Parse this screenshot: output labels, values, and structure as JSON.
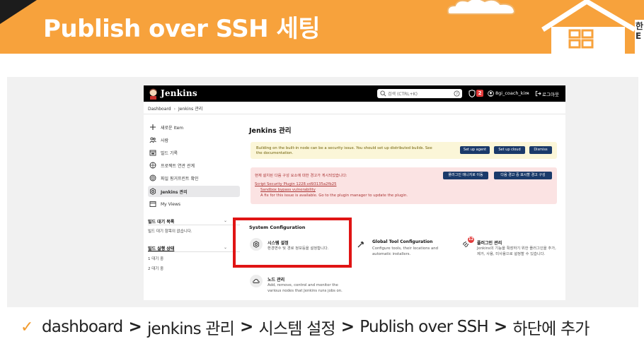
{
  "slide": {
    "title": "Publish over SSH 세팅",
    "corner_text": "한 E",
    "caption_steps": [
      "dashboard",
      "jenkins 관리",
      "시스템 설정",
      "Publish over SSH",
      "하단에 추가"
    ],
    "caption_separator": ">",
    "colors": {
      "accent": "#f7a23c",
      "highlight": "#e01414"
    }
  },
  "jenkins": {
    "brand": "Jenkins",
    "search_placeholder": "검색 (CTRL+K)",
    "alert_count": "2",
    "user": "8gi_coach_kim",
    "logout": "로그아웃",
    "breadcrumb": [
      "Dashboard",
      "Jenkins 관리"
    ],
    "sidebar": {
      "items": [
        {
          "label": "새로운 Item",
          "icon": "plus-icon"
        },
        {
          "label": "사람",
          "icon": "people-icon"
        },
        {
          "label": "빌드 기록",
          "icon": "history-icon"
        },
        {
          "label": "프로젝트 연관 관계",
          "icon": "relationship-icon"
        },
        {
          "label": "파일 핑거프린트 확인",
          "icon": "fingerprint-icon"
        },
        {
          "label": "Jenkins 관리",
          "icon": "gear-icon",
          "active": true
        },
        {
          "label": "My Views",
          "icon": "views-icon"
        }
      ],
      "queue_title": "빌드 대기 목록",
      "queue_empty": "빌드 대기 항목이 없습니다.",
      "executor_title": "빌드 실행 상태",
      "executors": [
        "1 대기 중",
        "2 대기 중"
      ]
    },
    "page_title": "Jenkins 관리",
    "warning_yellow": {
      "text": "Building on the built-in node can be a security issue. You should set up distributed builds. See the documentation.",
      "buttons": [
        "Set up agent",
        "Set up cloud",
        "Dismiss"
      ]
    },
    "warning_red": {
      "intro": "현재 설치된 다음 구성 요소에 대한 경고가 게시되었습니다:",
      "plugin": "Script Security Plugin 1228.vd93135a2fb25",
      "vuln": "Sandbox bypass vulnerability",
      "fix": "A fix for this issue is available. Go to the plugin manager to update the plugin.",
      "buttons": [
        "플러그인 매니저로 이동",
        "다음 경고 중 표시할 경고 구성"
      ]
    },
    "system_config": {
      "heading": "System Configuration",
      "cards": [
        {
          "title": "시스템 설정",
          "desc": "환경변수 및 경로 정보등을 설정합니다.",
          "icon": "gear-icon"
        },
        {
          "title": "Global Tool Configuration",
          "desc": "Configure tools, their locations and automatic installers.",
          "icon": "hammer-icon"
        },
        {
          "title": "플러그인 관리",
          "desc": "Jenkins의 기능을 확장하기 위한 플러그인을 추가, 제거, 사용, 미사용으로 설정할 수 있습니다.",
          "icon": "plug-icon",
          "badge": "12"
        },
        {
          "title": "노드 관리",
          "desc": "Add, remove, control and monitor the various nodes that Jenkins runs jobs on.",
          "icon": "cloud-icon"
        }
      ]
    }
  }
}
